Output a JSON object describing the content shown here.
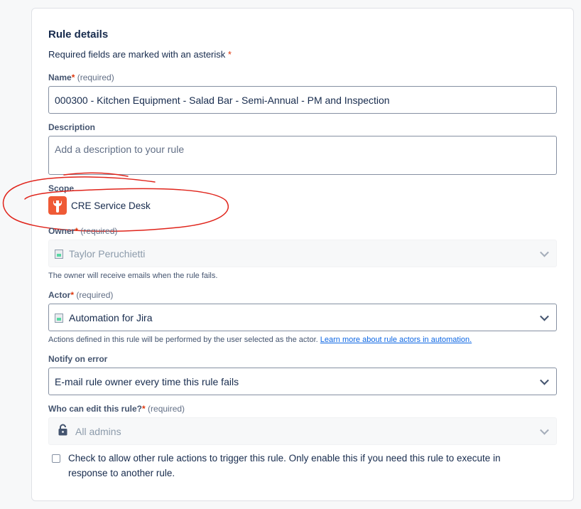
{
  "section": {
    "title": "Rule details",
    "required_note": "Required fields are marked with an asterisk",
    "asterisk": "*"
  },
  "name_field": {
    "label": "Name",
    "required_text": "(required)",
    "value": "000300 - Kitchen Equipment - Salad Bar - Semi-Annual - PM and Inspection"
  },
  "description_field": {
    "label": "Description",
    "placeholder": "Add a description to your rule"
  },
  "scope": {
    "label": "Scope",
    "project": "CRE Service Desk",
    "icon": "wrench-project-icon"
  },
  "owner_field": {
    "label": "Owner",
    "required_text": "(required)",
    "value": "Taylor Peruchietti",
    "help": "The owner will receive emails when the rule fails."
  },
  "actor_field": {
    "label": "Actor",
    "required_text": "(required)",
    "value": "Automation for Jira",
    "help": "Actions defined in this rule will be performed by the user selected as the actor.",
    "help_link": "Learn more about rule actors in automation."
  },
  "notify_field": {
    "label": "Notify on error",
    "value": "E-mail rule owner every time this rule fails"
  },
  "editors_field": {
    "label": "Who can edit this rule?",
    "required_text": "(required)",
    "value": "All admins",
    "icon": "lock-icon"
  },
  "trigger_option": {
    "checked": false,
    "text": "Check to allow other rule actions to trigger this rule. Only enable this if you need this rule to execute in response to another rule."
  },
  "annotation": {
    "color": "#e0241b",
    "shape": "hand-drawn ellipse around scope"
  },
  "colors": {
    "accent_red": "#de350b",
    "scope_icon": "#ef5a36",
    "link": "#0c66e4"
  }
}
